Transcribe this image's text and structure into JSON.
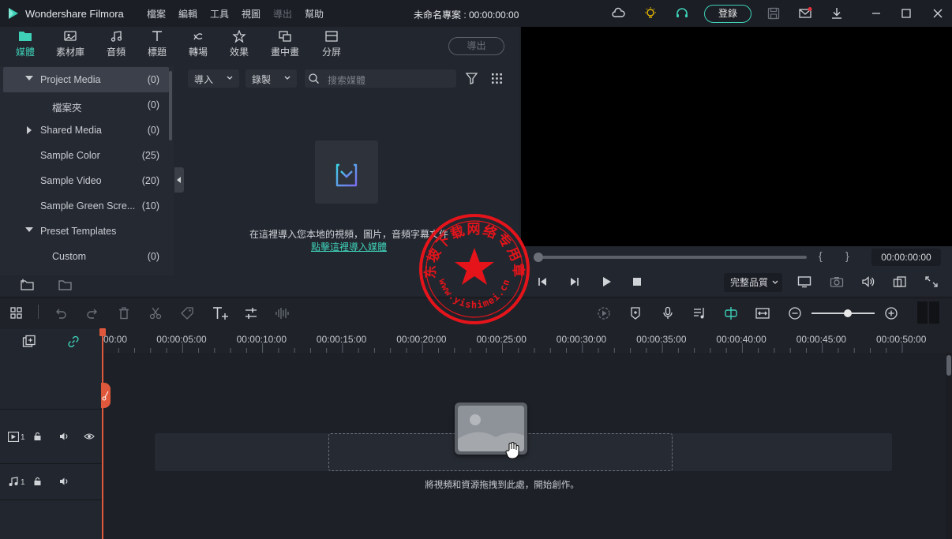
{
  "app": {
    "name": "Wondershare Filmora",
    "menu": [
      "檔案",
      "編輯",
      "工具",
      "視圖",
      "導出",
      "幫助"
    ],
    "project_title": "未命名專案 : 00:00:00:00",
    "login_label": "登錄"
  },
  "media_tabs": [
    {
      "label": "媒體",
      "icon": "folder-icon",
      "active": true
    },
    {
      "label": "素材庫",
      "icon": "stock-image-icon"
    },
    {
      "label": "音頻",
      "icon": "music-note-icon"
    },
    {
      "label": "標題",
      "icon": "title-t-icon"
    },
    {
      "label": "轉場",
      "icon": "transition-icon"
    },
    {
      "label": "效果",
      "icon": "effects-star-icon"
    },
    {
      "label": "畫中畫",
      "icon": "pip-icon"
    },
    {
      "label": "分屏",
      "icon": "split-screen-icon"
    }
  ],
  "export_label": "導出",
  "tree": [
    {
      "label": "Project Media",
      "count": "(0)",
      "expanded": true,
      "selected": true
    },
    {
      "label": "檔案夾",
      "count": "(0)",
      "child": true
    },
    {
      "label": "Shared Media",
      "count": "(0)",
      "collapsed": true
    },
    {
      "label": "Sample Color",
      "count": "(25)"
    },
    {
      "label": "Sample Video",
      "count": "(20)"
    },
    {
      "label": "Sample Green Scre...",
      "count": "(10)"
    },
    {
      "label": "Preset Templates",
      "count": "",
      "expanded": true
    },
    {
      "label": "Custom",
      "count": "(0)",
      "child": true
    }
  ],
  "media_toolbar": {
    "import_label": "導入",
    "record_label": "錄製",
    "search_placeholder": "搜索媒體"
  },
  "import_area": {
    "hint": "在這裡導入您本地的視頻，圖片，音頻字幕文件",
    "link": "點擊這裡導入媒體"
  },
  "preview": {
    "timecode": "00:00:00:00",
    "quality": "完整品質",
    "mark_in": "{",
    "mark_out": "}"
  },
  "ruler_labels": [
    "00:00",
    "00:00:05:00",
    "00:00:10:00",
    "00:00:15:00",
    "00:00:20:00",
    "00:00:25:00",
    "00:00:30:00",
    "00:00:35:00",
    "00:00:40:00",
    "00:00:45:00",
    "00:00:50:00"
  ],
  "tracks": {
    "video_num": "1",
    "audio_num": "1"
  },
  "drop_hint": "將視頻和資源拖拽到此處，開始創作。",
  "stamp": {
    "top_text": "东坡下载网络专用章",
    "bottom_text": "www.yishimei.cn"
  },
  "colors": {
    "accent": "#3fd0b8",
    "playhead": "#e0583b",
    "stamp": "#e5141b"
  }
}
